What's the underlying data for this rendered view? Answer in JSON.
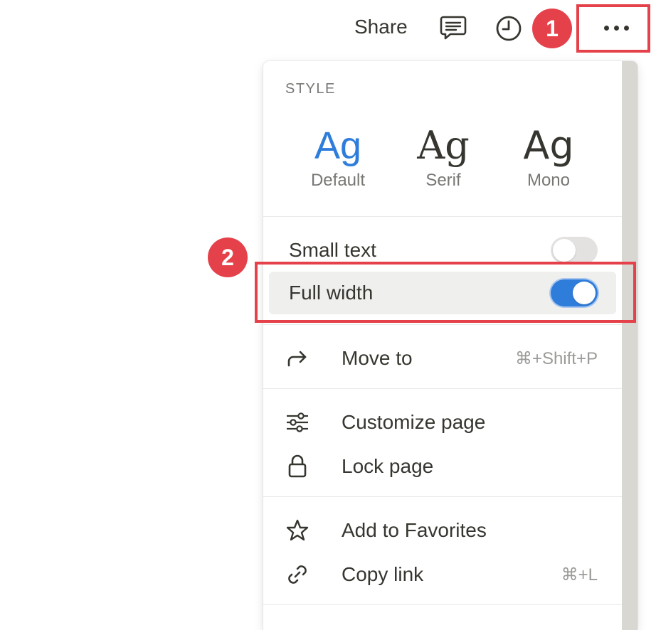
{
  "topbar": {
    "share_label": "Share",
    "comment_icon": "comment-icon",
    "history_icon": "clock-icon",
    "favorite_icon": "star-icon",
    "more_icon": "more-horizontal-icon"
  },
  "annotations": {
    "step1": "1",
    "step2": "2",
    "highlight_color": "#e5414a"
  },
  "menu": {
    "style_label": "STYLE",
    "fonts": [
      {
        "sample": "Ag",
        "label": "Default",
        "selected": true
      },
      {
        "sample": "Ag",
        "label": "Serif",
        "selected": false
      },
      {
        "sample": "Ag",
        "label": "Mono",
        "selected": false
      }
    ],
    "toggles": {
      "small_text": {
        "label": "Small text",
        "on": false
      },
      "full_width": {
        "label": "Full width",
        "on": true
      }
    },
    "items": {
      "move_to": {
        "label": "Move to",
        "shortcut": "⌘+Shift+P",
        "icon": "arrow-turn-right-icon"
      },
      "customize": {
        "label": "Customize page",
        "icon": "sliders-icon"
      },
      "lock": {
        "label": "Lock page",
        "icon": "lock-icon"
      },
      "favorites": {
        "label": "Add to Favorites",
        "icon": "star-icon"
      },
      "copy_link": {
        "label": "Copy link",
        "shortcut": "⌘+L",
        "icon": "link-icon"
      }
    }
  },
  "colors": {
    "accent": "#2f7ddb",
    "text": "#37352f",
    "muted": "#787774"
  }
}
